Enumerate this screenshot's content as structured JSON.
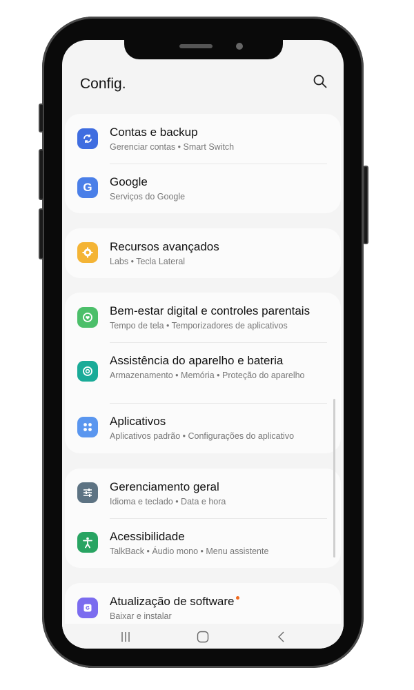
{
  "header": {
    "title": "Config.",
    "search_icon": "search-icon"
  },
  "groups": [
    {
      "items": [
        {
          "title": "Contas e backup",
          "subtitle": "Gerenciar contas  •  Smart Switch",
          "icon": "sync-icon",
          "color": "#3f6de0"
        },
        {
          "title": "Google",
          "subtitle": "Serviços do Google",
          "icon": "google-g-icon",
          "color": "#4a7fe8"
        }
      ]
    },
    {
      "items": [
        {
          "title": "Recursos avançados",
          "subtitle": "Labs  •  Tecla Lateral",
          "icon": "gear-plus-icon",
          "color": "#f4b435"
        }
      ]
    },
    {
      "items": [
        {
          "title": "Bem-estar digital e controles parentais",
          "subtitle": "Tempo de tela  •  Temporizadores de aplicativos",
          "icon": "heart-ring-icon",
          "color": "#4cbf6a"
        },
        {
          "title": "Assistência do aparelho e bateria",
          "subtitle": "Armazenamento  •  Memória  •  Proteção do aparelho",
          "icon": "device-care-icon",
          "color": "#1aab98"
        },
        {
          "title": "Aplicativos",
          "subtitle": "Aplicativos padrão  •  Configurações do aplicativo",
          "icon": "apps-grid-icon",
          "color": "#5a96ef"
        }
      ]
    },
    {
      "items": [
        {
          "title": "Gerenciamento geral",
          "subtitle": "Idioma e teclado  •  Data e hora",
          "icon": "sliders-icon",
          "color": "#5d7383"
        },
        {
          "title": "Acessibilidade",
          "subtitle": "TalkBack  •  Áudio mono  •  Menu assistente",
          "icon": "accessibility-icon",
          "color": "#28a462"
        }
      ]
    },
    {
      "items": [
        {
          "title": "Atualização de software",
          "subtitle": "Baixar e instalar",
          "icon": "update-icon",
          "color": "#7b6cef",
          "badge": true
        }
      ]
    }
  ],
  "navbar": {
    "recent": "recent-apps-icon",
    "home": "home-icon",
    "back": "back-icon"
  }
}
